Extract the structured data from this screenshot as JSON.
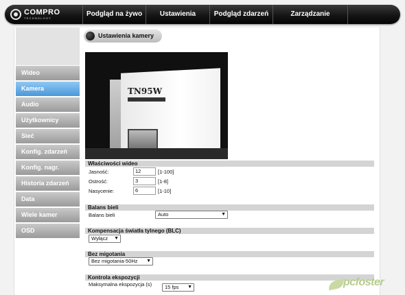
{
  "logo": {
    "name": "COMPRO",
    "sub": "TECHNOLOGY"
  },
  "nav": [
    {
      "label": "Podgląd na żywo"
    },
    {
      "label": "Ustawienia"
    },
    {
      "label": "Podgląd zdarzeń"
    },
    {
      "label": "Zarządzanie"
    }
  ],
  "sidebar": [
    {
      "label": "Wideo",
      "active": false
    },
    {
      "label": "Kamera",
      "active": true
    },
    {
      "label": "Audio",
      "active": false
    },
    {
      "label": "Użytkownicy",
      "active": false
    },
    {
      "label": "Sieć",
      "active": false
    },
    {
      "label": "Konfig. zdarzeń",
      "active": false
    },
    {
      "label": "Konfig. nagr.",
      "active": false
    },
    {
      "label": "Historia zdarzeń",
      "active": false
    },
    {
      "label": "Data",
      "active": false
    },
    {
      "label": "Wiele kamer",
      "active": false
    },
    {
      "label": "OSD",
      "active": false
    }
  ],
  "page_title": "Ustawienia kamery",
  "camera_preview": {
    "label": "TN95W"
  },
  "video_props": {
    "title": "Właściwości wideo",
    "brightness": {
      "label": "Jasność:",
      "value": "12",
      "range": "[1-100]"
    },
    "sharpness": {
      "label": "Ostrość:",
      "value": "3",
      "range": "[1-8]"
    },
    "saturation": {
      "label": "Nasycenie:",
      "value": "6",
      "range": "[1-10]"
    }
  },
  "white_balance": {
    "title": "Balans bieli",
    "label": "Balans bieli",
    "value": "Auto"
  },
  "blc": {
    "title": "Kompensacja światła tylnego (BLC)",
    "value": "Wyłącz"
  },
  "flicker": {
    "title": "Bez migotania",
    "value": "Bez migotania-50Hz"
  },
  "exposure": {
    "title": "Kontrola ekspozycji",
    "label": "Maksymalna ekspozycja (s)",
    "value": "15 fps"
  },
  "watermark": "pcfoster"
}
